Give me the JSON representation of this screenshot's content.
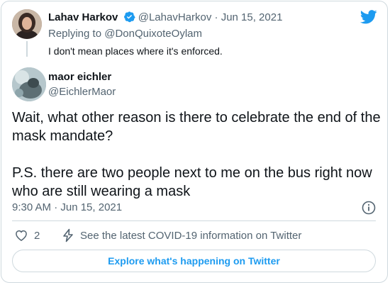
{
  "parent_tweet": {
    "name": "Lahav Harkov",
    "handle": "@LahavHarkov",
    "separator": "·",
    "date": "Jun 15, 2021",
    "replying_to": "Replying to @DonQuixoteOylam",
    "text": "I don't mean places where it's enforced."
  },
  "main_tweet": {
    "name": "maor eichler",
    "handle": "@EichlerMaor",
    "paragraph1": "Wait, what other reason is there to celebrate the end of the mask mandate?",
    "paragraph2": "P.S. there are two people next to me on the bus right now who are still wearing a mask",
    "timestamp": "9:30 AM · Jun 15, 2021"
  },
  "actions": {
    "like_count": "2",
    "covid_link": "See the latest COVID-19 information on Twitter"
  },
  "explore_button": "Explore what's happening on Twitter",
  "icons": {
    "brand": "twitter-bird-icon",
    "verified": "verified-badge-icon",
    "info": "info-icon",
    "like": "heart-icon",
    "covid": "lightning-bolt-icon"
  },
  "colors": {
    "brand_blue": "#1d9bf0",
    "muted_text": "#536471",
    "border": "#cfd9de"
  }
}
